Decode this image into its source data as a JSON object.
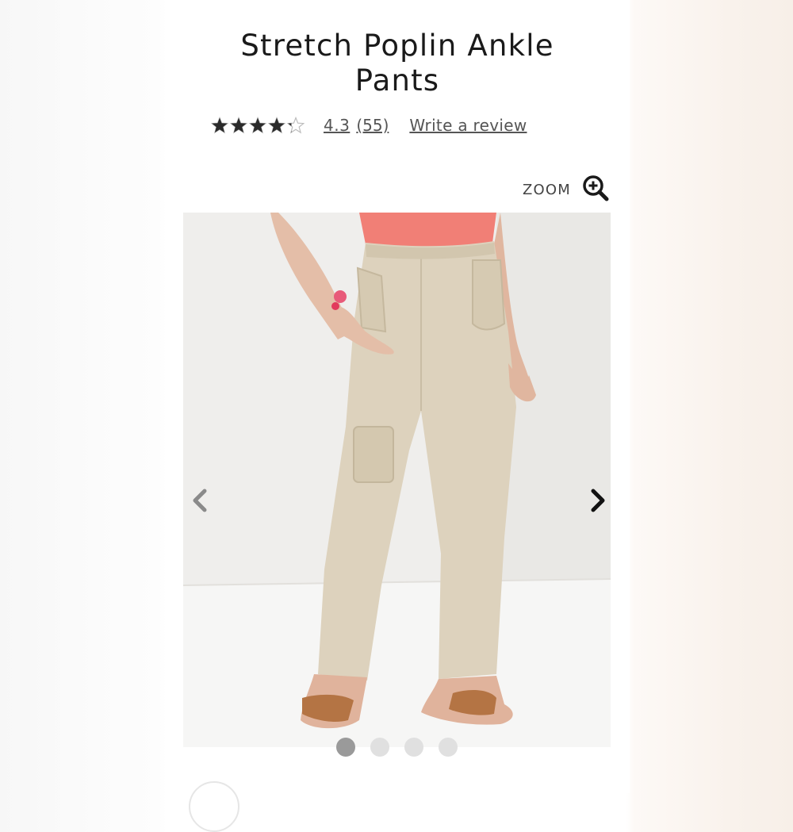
{
  "product": {
    "title_line1": "Stretch Poplin Ankle",
    "title_line2": "Pants"
  },
  "rating": {
    "value": "4.3",
    "count": "(55)",
    "stars_filled_fraction": 0.86,
    "write_review": "Write a review"
  },
  "zoom": {
    "label": "ZOOM",
    "icon": "zoom-in-icon"
  },
  "gallery": {
    "image_alt": "model wearing khaki cargo pants",
    "prev_icon": "chevron-left-icon",
    "next_icon": "chevron-right-icon",
    "dots_count": 4,
    "active_dot": 0
  },
  "colors": {
    "pants": "#ddd2bd",
    "top": "#f0857a",
    "sandal": "#b47444",
    "skin": "#e2b8a2",
    "background": "#eceae6"
  }
}
